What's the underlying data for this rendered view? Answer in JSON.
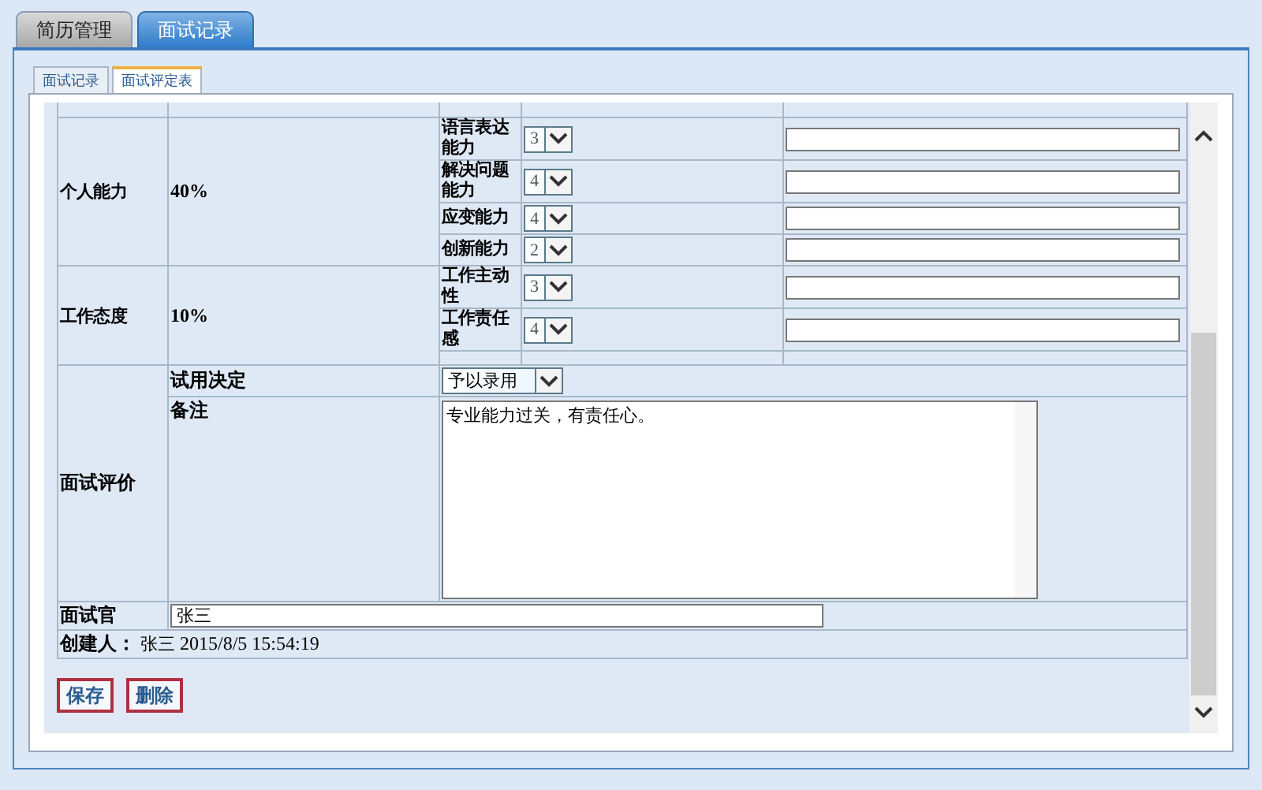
{
  "tabs": [
    {
      "label": "简历管理",
      "selected": false
    },
    {
      "label": "面试记录",
      "selected": true
    }
  ],
  "sub_tabs": [
    {
      "label": "面试记录",
      "selected": false
    },
    {
      "label": "面试评定表",
      "selected": true
    }
  ],
  "groups": [
    {
      "name": "个人能力",
      "weight": "40%",
      "items": [
        {
          "label": "语言表达能力",
          "score": "3"
        },
        {
          "label": "解决问题能力",
          "score": "4"
        },
        {
          "label": "应变能力",
          "score": "4"
        },
        {
          "label": "创新能力",
          "score": "2"
        }
      ]
    },
    {
      "name": "工作态度",
      "weight": "10%",
      "items": [
        {
          "label": "工作主动性",
          "score": "3"
        },
        {
          "label": "工作责任感",
          "score": "4"
        }
      ]
    }
  ],
  "evaluation": {
    "label": "面试评价",
    "decision_label": "试用决定",
    "decision": "予以录用",
    "remark_label": "备注",
    "remark": "专业能力过关，有责任心。"
  },
  "interviewer": {
    "label": "面试官",
    "value": "张三"
  },
  "creator": {
    "label": "创建人：",
    "name": "张三",
    "time": "2015/8/5 15:54:19"
  },
  "buttons": [
    "保存",
    "删除"
  ]
}
